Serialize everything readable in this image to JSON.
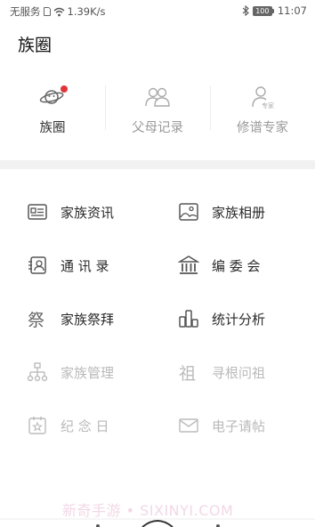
{
  "status": {
    "carrier": "无服务",
    "speed": "1.39K/s",
    "battery": "100",
    "time": "11:07"
  },
  "header": {
    "title": "族圈"
  },
  "tabs": [
    {
      "label": "族圈",
      "icon": "planet-icon",
      "active": true,
      "has_badge": true
    },
    {
      "label": "父母记录",
      "icon": "people-icon",
      "active": false,
      "has_badge": false
    },
    {
      "label": "修谱专家",
      "icon": "expert-icon",
      "active": false,
      "has_badge": false
    }
  ],
  "menu": [
    {
      "label": "家族资讯",
      "icon": "id-card-icon",
      "enabled": true
    },
    {
      "label": "家族相册",
      "icon": "photo-album-icon",
      "enabled": true
    },
    {
      "label": "通 讯 录",
      "icon": "contacts-icon",
      "enabled": true
    },
    {
      "label": "编 委 会",
      "icon": "institution-icon",
      "enabled": true
    },
    {
      "label": "家族祭拜",
      "icon": "worship-icon",
      "enabled": true
    },
    {
      "label": "统计分析",
      "icon": "bar-chart-icon",
      "enabled": true
    },
    {
      "label": "家族管理",
      "icon": "org-tree-icon",
      "enabled": false
    },
    {
      "label": "寻根问祖",
      "icon": "ancestor-icon",
      "enabled": false
    },
    {
      "label": "纪 念 日",
      "icon": "calendar-star-icon",
      "enabled": false
    },
    {
      "label": "电子请帖",
      "icon": "envelope-icon",
      "enabled": false
    }
  ],
  "watermark": "新奇手游 • SIXINYI.COM",
  "colors": {
    "accent_red": "#e0353a",
    "disabled_text": "#b9b9b9",
    "band": "#f1f1f1"
  }
}
